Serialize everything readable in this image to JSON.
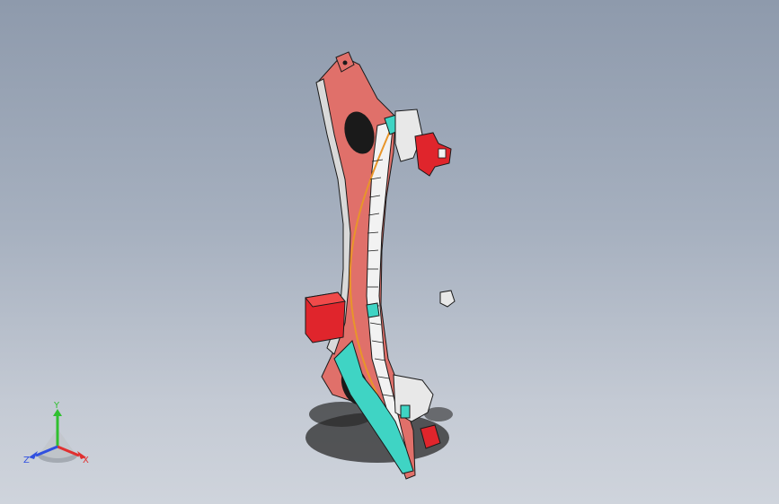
{
  "viewport": {
    "background_top": "#8e9aac",
    "background_bottom": "#cfd4dc"
  },
  "model": {
    "part_color_primary": "#e0706a",
    "accent_color_red": "#e0252c",
    "accent_color_cyan": "#3fd4c4",
    "accent_color_orange": "#e8952a",
    "edge_color": "#1a1a1a"
  },
  "triad": {
    "x_label": "X",
    "y_label": "Y",
    "z_label": "Z",
    "x_color": "#e03030",
    "y_color": "#30c030",
    "z_color": "#3050e0"
  }
}
